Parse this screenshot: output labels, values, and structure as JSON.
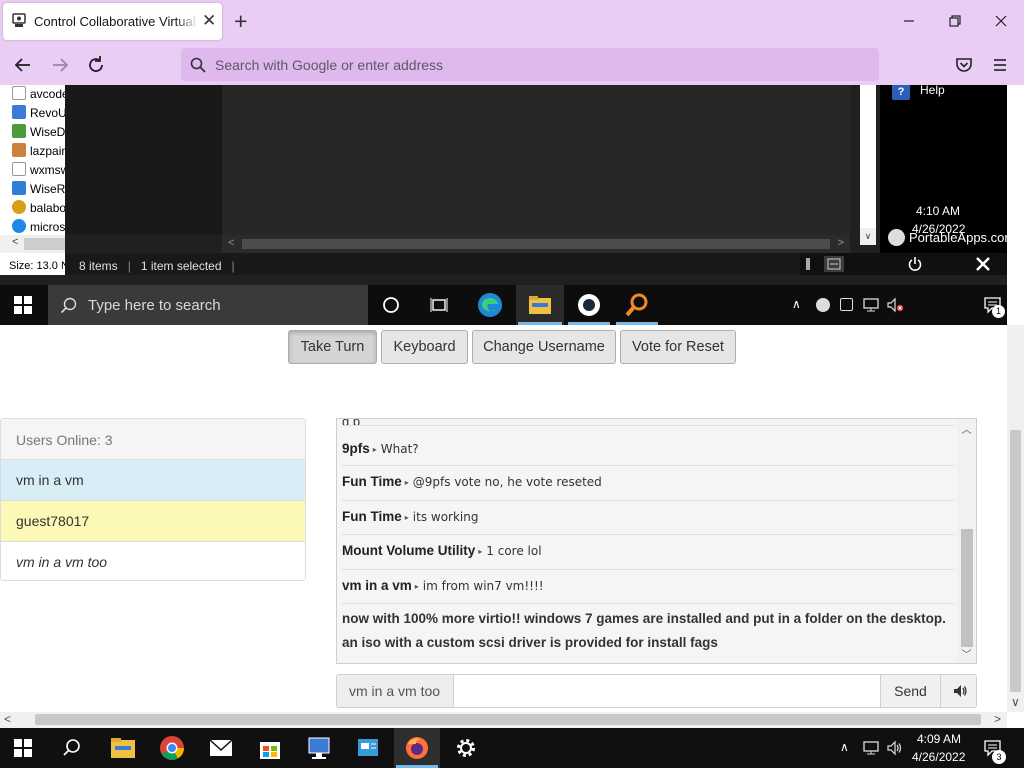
{
  "browser": {
    "tab_title": "Control Collaborative Virtual Machine",
    "tab_close": "✕",
    "new_tab": "+",
    "url_placeholder": "Search with Google or enter address"
  },
  "vm": {
    "tree_items": [
      "avcode",
      "RevoU",
      "WiseD",
      "lazpain",
      "wxmsw",
      "WiseRe",
      "balabo",
      "micros"
    ],
    "tree_size_label": "Size: 13.0 N",
    "explorer_status": {
      "items_count": "8 items",
      "selected": "1 item selected"
    },
    "portableapps": {
      "help_label": "Help",
      "brand": "PortableApps.com"
    },
    "taskbar": {
      "search_placeholder": "Type here to search",
      "time": "4:10 AM",
      "date": "4/26/2022",
      "notification_count": "1"
    }
  },
  "controls": {
    "take_turn": "Take Turn",
    "keyboard": "Keyboard",
    "change_username": "Change Username",
    "vote_reset": "Vote for Reset"
  },
  "users": {
    "header": "Users Online: 3",
    "list": [
      {
        "name": "vm in a vm",
        "bg": "#d9edf7"
      },
      {
        "name": "guest78017",
        "bg": "#fcf8b5"
      },
      {
        "name": "vm in a vm too",
        "bg": "#ffffff"
      }
    ]
  },
  "chat": {
    "partial_text": "g                  p",
    "messages": [
      {
        "user": "9pfs",
        "text": "What?"
      },
      {
        "user": "Fun Time",
        "text": "@9pfs vote no, he vote reseted"
      },
      {
        "user": "Fun Time",
        "text": "its working"
      },
      {
        "user": "Mount Volume Utility",
        "text": "1 core lol"
      },
      {
        "user": "vm in a vm",
        "text": "im from win7 vm!!!!"
      }
    ],
    "announcement": "now with 100% more virtio!! windows 7 games are installed and put in a folder on the desktop. an iso with a custom scsi driver is provided for install fags",
    "username": "vm in a vm too",
    "input_value": "",
    "send_label": "Send"
  },
  "host_taskbar": {
    "time": "4:09 AM",
    "date": "4/26/2022",
    "notification_count": "3"
  },
  "colors": {
    "browser_chrome": "#e9cdf5",
    "user_active_bg": "#d9edf7",
    "user_turn_bg": "#fcf8b5"
  }
}
